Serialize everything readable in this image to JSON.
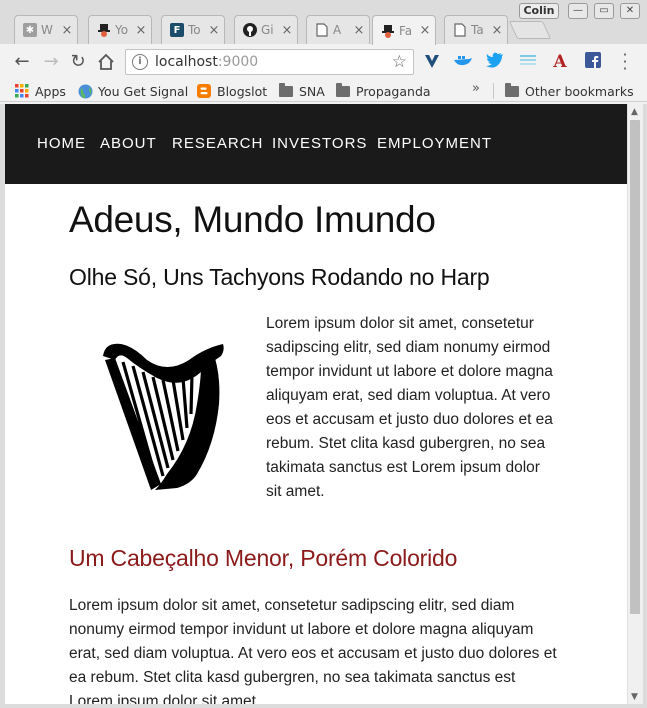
{
  "browser": {
    "profile_name": "Colin",
    "tabs": [
      {
        "title": "W",
        "favicon": "puzzle-icon",
        "active": false
      },
      {
        "title": "Yo",
        "favicon": "hat-icon",
        "active": false
      },
      {
        "title": "To",
        "favicon": "letter-f-icon",
        "favicon_text": "F",
        "active": false
      },
      {
        "title": "Gi",
        "favicon": "github-icon",
        "active": false
      },
      {
        "title": "A",
        "favicon": "page-icon",
        "active": false
      },
      {
        "title": "Fa",
        "favicon": "hat-icon",
        "active": true
      },
      {
        "title": "Ta",
        "favicon": "page-icon",
        "active": false
      }
    ],
    "tab_close_glyph": "×",
    "address": {
      "host": "localhost",
      "port": ":9000"
    },
    "bookmarks": [
      {
        "label": "Apps",
        "icon": "apps-grid-icon"
      },
      {
        "label": "You Get Signal",
        "icon": "globe-icon"
      },
      {
        "label": "Blogslot",
        "icon": "blogger-icon"
      },
      {
        "label": "SNA",
        "icon": "folder-icon"
      },
      {
        "label": "Propaganda",
        "icon": "folder-icon"
      }
    ],
    "overflow_glyph": "»",
    "other_bookmarks": "Other bookmarks",
    "colors": {
      "accent_blue": "#1da1f2",
      "blogger_orange": "#f57d00",
      "facebook_blue": "#3b5998"
    }
  },
  "site": {
    "nav": [
      "HOME",
      "ABOUT",
      "RESEARCH",
      "INVESTORS",
      "EMPLOYMENT"
    ],
    "title": "Adeus, Mundo Imundo",
    "subtitle": "Olhe Só, Uns Tachyons Rodando no Harp",
    "paragraph1": "Lorem ipsum dolor sit amet, consetetur sadipscing elitr, sed diam nonumy eirmod tempor invidunt ut labore et dolore magna aliquyam erat, sed diam voluptua. At vero eos et accusam et justo duo dolores et ea rebum. Stet clita kasd gubergren, no sea takimata sanctus est Lorem ipsum dolor sit amet.",
    "colored_heading": "Um Cabeçalho Menor, Porém Colorido",
    "paragraph2": "Lorem ipsum dolor sit amet, consetetur sadipscing elitr, sed diam nonumy eirmod tempor invidunt ut labore et dolore magna aliquyam erat, sed diam voluptua. At vero eos et accusam et justo duo dolores et ea rebum. Stet clita kasd gubergren, no sea takimata sanctus est Lorem ipsum dolor sit amet.",
    "colors": {
      "nav_bg": "#1a1a1a",
      "heading_red": "#8b1a1a"
    }
  }
}
